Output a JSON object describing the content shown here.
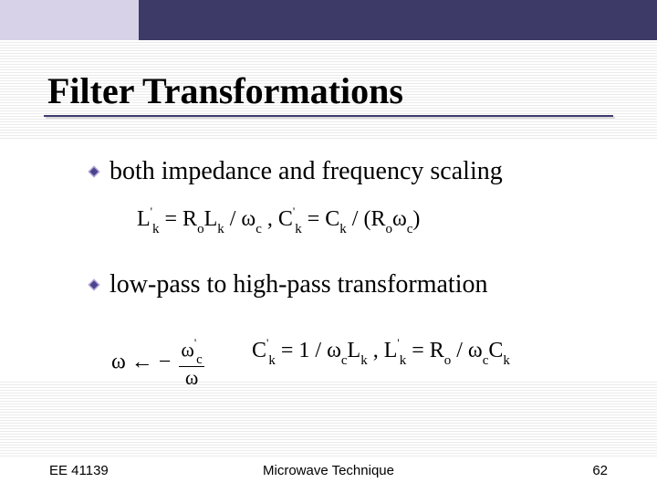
{
  "slide": {
    "title": "Filter Transformations",
    "bullets": [
      {
        "text": "both impedance and frequency scaling"
      },
      {
        "text": "low-pass to high-pass transformation"
      }
    ],
    "equations": {
      "eq1_html": "L<span class='sup'>'</span><span class='sub'>k</span> = R<span class='sub'>o</span>L<span class='sub'>k</span> / &omega;<span class='sub'>c</span> , C<span class='sup'>'</span><span class='sub'>k</span> = C<span class='sub'>k</span> / (R<span class='sub'>o</span>&omega;<span class='sub'>c</span>)",
      "eq2a_num": "&omega;<span class='sup'>'</span><span class='sub'>c</span>",
      "eq2a_den": "&omega;",
      "eq2a_prefix": "&omega; &larr; &minus;",
      "eq2b_html": "C<span class='sup'>'</span><span class='sub'>k</span> = 1 / &omega;<span class='sub'>c</span>L<span class='sub'>k</span> , L<span class='sup'>'</span><span class='sub'>k</span> = R<span class='sub'>o</span> / &omega;<span class='sub'>c</span>C<span class='sub'>k</span>"
    },
    "footer": {
      "left": "EE 41139",
      "center": "Microwave Technique",
      "right": "62"
    }
  }
}
